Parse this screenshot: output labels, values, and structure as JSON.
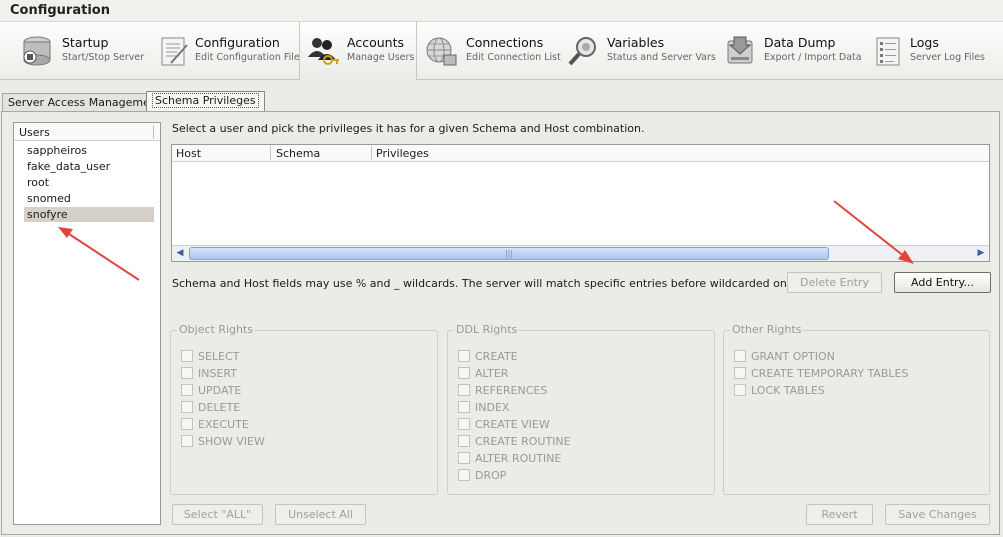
{
  "window": {
    "title": "Configuration"
  },
  "toolbar": {
    "items": [
      {
        "label": "Startup",
        "sublabel": "Start/Stop Server",
        "icon": "server-startup-icon"
      },
      {
        "label": "Configuration",
        "sublabel": "Edit Configuration File",
        "icon": "config-file-icon"
      },
      {
        "label": "Accounts",
        "sublabel": "Manage Users",
        "icon": "users-keys-icon"
      },
      {
        "label": "Connections",
        "sublabel": "Edit Connection List",
        "icon": "globe-connections-icon"
      },
      {
        "label": "Variables",
        "sublabel": "Status and Server Vars",
        "icon": "magnifier-variables-icon"
      },
      {
        "label": "Data Dump",
        "sublabel": "Export / Import Data",
        "icon": "drive-data-dump-icon"
      },
      {
        "label": "Logs",
        "sublabel": "Server Log Files",
        "icon": "log-document-icon"
      }
    ],
    "active": "Accounts"
  },
  "subtabs": [
    {
      "label": "Server Access Management"
    },
    {
      "label": "Schema Privileges"
    }
  ],
  "users": {
    "header": "Users",
    "items": [
      "sappheiros",
      "fake_data_user",
      "root",
      "snomed",
      "snofyre"
    ],
    "selected": "snofyre"
  },
  "main": {
    "instruction": "Select a user and pick the privileges it has for a given Schema and Host combination.",
    "columns": [
      "Host",
      "Schema",
      "Privileges"
    ],
    "note": "Schema and Host fields may use % and _ wildcards. The server will match specific entries before wildcarded ones.",
    "delete_entry": "Delete Entry",
    "add_entry": "Add Entry..."
  },
  "groups": {
    "object": {
      "title": "Object Rights",
      "items": [
        "SELECT",
        "INSERT",
        "UPDATE",
        "DELETE",
        "EXECUTE",
        "SHOW VIEW"
      ]
    },
    "ddl": {
      "title": "DDL Rights",
      "items": [
        "CREATE",
        "ALTER",
        "REFERENCES",
        "INDEX",
        "CREATE VIEW",
        "CREATE ROUTINE",
        "ALTER ROUTINE",
        "DROP"
      ]
    },
    "other": {
      "title": "Other Rights",
      "items": [
        "GRANT OPTION",
        "CREATE TEMPORARY TABLES",
        "LOCK TABLES"
      ]
    }
  },
  "footer": {
    "select_all": "Select \"ALL\"",
    "unselect_all": "Unselect All",
    "revert": "Revert",
    "save": "Save Changes"
  },
  "colors": {
    "annotation_arrow": "#e0463a",
    "selection": "#d6d0c8",
    "scroll_thumb": "#aac6ef"
  }
}
